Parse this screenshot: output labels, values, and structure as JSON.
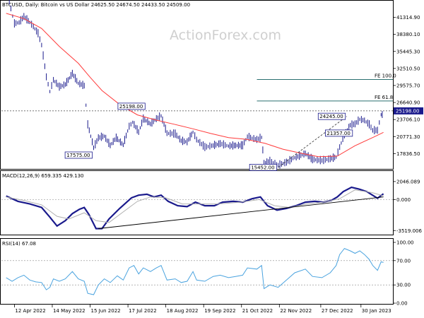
{
  "chart_data": [
    {
      "type": "candlestick",
      "panel": "price",
      "symbol_line": "BTCUSD, Daily:  Bitcoin vs US Dollar  24625.50  24674.50  24433.50  24509.00",
      "watermark": "ActionForex.com",
      "ylim": [
        15200,
        42600
      ],
      "y_ticks": [
        "41314.90",
        "38380.10",
        "35445.30",
        "32510.50",
        "29575.70",
        "26640.90",
        "23706.10",
        "20771.30",
        "17836.50"
      ],
      "x_dates": [
        "12 Apr 2022",
        "14 May 2022",
        "15 Jun 2022",
        "17 Jul 2022",
        "18 Aug 2022",
        "19 Sep 2022",
        "21 Oct 2022",
        "22 Nov 2022",
        "27 Dec 2022",
        "30 Jan 2023"
      ],
      "current_price": "25198.00",
      "current_price_value": 25198,
      "levels": [
        {
          "label": "FE 100.0",
          "value": 30600
        },
        {
          "label": "FE 61.8",
          "value": 26900
        },
        {
          "label": "",
          "value": 25198
        }
      ],
      "annotations": [
        {
          "label": "25198.00",
          "date": "2022-07-20",
          "value": 25198,
          "side": "above"
        },
        {
          "label": "17575.00",
          "date": "2022-06-18",
          "value": 17575,
          "side": "left"
        },
        {
          "label": "15452.00",
          "date": "2022-11-21",
          "value": 15452,
          "side": "left"
        },
        {
          "label": "24245.00",
          "date": "2023-01-18",
          "value": 24245,
          "side": "left"
        },
        {
          "label": "21357.00",
          "date": "2023-01-24",
          "value": 21357,
          "side": "left"
        }
      ],
      "close_path": [
        [
          "2022-04-05",
          46000
        ],
        [
          "2022-04-09",
          42800
        ],
        [
          "2022-04-12",
          40200
        ],
        [
          "2022-04-16",
          40400
        ],
        [
          "2022-04-20",
          41400
        ],
        [
          "2022-04-25",
          40400
        ],
        [
          "2022-04-28",
          39700
        ],
        [
          "2022-05-02",
          38500
        ],
        [
          "2022-05-05",
          36500
        ],
        [
          "2022-05-09",
          31000
        ],
        [
          "2022-05-12",
          28500
        ],
        [
          "2022-05-15",
          30500
        ],
        [
          "2022-05-20",
          29300
        ],
        [
          "2022-05-25",
          29700
        ],
        [
          "2022-05-31",
          31600
        ],
        [
          "2022-06-05",
          29900
        ],
        [
          "2022-06-10",
          29500
        ],
        [
          "2022-06-13",
          22800
        ],
        [
          "2022-06-18",
          18800
        ],
        [
          "2022-06-22",
          20500
        ],
        [
          "2022-06-27",
          20800
        ],
        [
          "2022-07-02",
          19200
        ],
        [
          "2022-07-07",
          20500
        ],
        [
          "2022-07-13",
          19300
        ],
        [
          "2022-07-18",
          22500
        ],
        [
          "2022-07-21",
          23200
        ],
        [
          "2022-07-26",
          21500
        ],
        [
          "2022-07-30",
          23800
        ],
        [
          "2022-08-05",
          22900
        ],
        [
          "2022-08-10",
          23800
        ],
        [
          "2022-08-14",
          24300
        ],
        [
          "2022-08-19",
          21300
        ],
        [
          "2022-08-26",
          21200
        ],
        [
          "2022-08-31",
          20000
        ],
        [
          "2022-09-05",
          19800
        ],
        [
          "2022-09-10",
          21500
        ],
        [
          "2022-09-13",
          20200
        ],
        [
          "2022-09-20",
          18900
        ],
        [
          "2022-09-27",
          19200
        ],
        [
          "2022-10-03",
          19500
        ],
        [
          "2022-10-10",
          19100
        ],
        [
          "2022-10-16",
          19200
        ],
        [
          "2022-10-22",
          19200
        ],
        [
          "2022-10-26",
          20700
        ],
        [
          "2022-11-03",
          20200
        ],
        [
          "2022-11-07",
          20600
        ],
        [
          "2022-11-09",
          16200
        ],
        [
          "2022-11-14",
          16500
        ],
        [
          "2022-11-21",
          15800
        ],
        [
          "2022-11-28",
          16300
        ],
        [
          "2022-12-05",
          17100
        ],
        [
          "2022-12-14",
          17800
        ],
        [
          "2022-12-20",
          16800
        ],
        [
          "2022-12-28",
          16600
        ],
        [
          "2023-01-04",
          16900
        ],
        [
          "2023-01-09",
          17200
        ],
        [
          "2023-01-12",
          18900
        ],
        [
          "2023-01-16",
          21100
        ],
        [
          "2023-01-21",
          22700
        ],
        [
          "2023-01-25",
          22900
        ],
        [
          "2023-01-29",
          23700
        ],
        [
          "2023-02-02",
          23500
        ],
        [
          "2023-02-06",
          22800
        ],
        [
          "2023-02-09",
          21800
        ],
        [
          "2023-02-13",
          21800
        ],
        [
          "2023-02-16",
          24500
        ],
        [
          "2023-02-18",
          24509
        ]
      ],
      "ma_path": [
        [
          "2022-04-05",
          42000
        ],
        [
          "2022-04-20",
          41100
        ],
        [
          "2022-05-05",
          39400
        ],
        [
          "2022-05-20",
          36300
        ],
        [
          "2022-06-05",
          33400
        ],
        [
          "2022-06-15",
          31000
        ],
        [
          "2022-06-25",
          28700
        ],
        [
          "2022-07-10",
          26300
        ],
        [
          "2022-07-25",
          24500
        ],
        [
          "2022-08-10",
          23600
        ],
        [
          "2022-08-25",
          22900
        ],
        [
          "2022-09-10",
          22100
        ],
        [
          "2022-09-25",
          21300
        ],
        [
          "2022-10-10",
          20600
        ],
        [
          "2022-10-25",
          20300
        ],
        [
          "2022-11-10",
          19600
        ],
        [
          "2022-11-25",
          18600
        ],
        [
          "2022-12-10",
          17900
        ],
        [
          "2022-12-25",
          17300
        ],
        [
          "2023-01-10",
          17400
        ],
        [
          "2023-01-25",
          19200
        ],
        [
          "2023-02-10",
          20700
        ],
        [
          "2023-02-18",
          21500
        ]
      ],
      "trend_path": [
        [
          "2022-11-21",
          15452
        ],
        [
          "2023-01-18",
          24245
        ]
      ]
    },
    {
      "type": "line",
      "panel": "macd",
      "label": "MACD(12,26,9) 659.335 429.130",
      "ylim": [
        -3900,
        2600
      ],
      "y_ticks": [
        "2046.089",
        "0.000",
        "-3519.006"
      ],
      "series": [
        {
          "name": "MACD",
          "color": "#1a1a8c",
          "points": [
            [
              "2022-04-05",
              400
            ],
            [
              "2022-04-15",
              -200
            ],
            [
              "2022-04-25",
              -500
            ],
            [
              "2022-05-05",
              -900
            ],
            [
              "2022-05-12",
              -2000
            ],
            [
              "2022-05-18",
              -3000
            ],
            [
              "2022-05-25",
              -2400
            ],
            [
              "2022-05-31",
              -1600
            ],
            [
              "2022-06-06",
              -1100
            ],
            [
              "2022-06-10",
              -900
            ],
            [
              "2022-06-14",
              -1700
            ],
            [
              "2022-06-20",
              -3300
            ],
            [
              "2022-06-25",
              -3300
            ],
            [
              "2022-07-01",
              -2200
            ],
            [
              "2022-07-10",
              -1000
            ],
            [
              "2022-07-20",
              200
            ],
            [
              "2022-07-26",
              500
            ],
            [
              "2022-08-02",
              600
            ],
            [
              "2022-08-08",
              300
            ],
            [
              "2022-08-14",
              500
            ],
            [
              "2022-08-20",
              -200
            ],
            [
              "2022-08-28",
              -700
            ],
            [
              "2022-09-05",
              -800
            ],
            [
              "2022-09-12",
              -300
            ],
            [
              "2022-09-20",
              -700
            ],
            [
              "2022-09-28",
              -700
            ],
            [
              "2022-10-05",
              -300
            ],
            [
              "2022-10-14",
              -200
            ],
            [
              "2022-10-22",
              -300
            ],
            [
              "2022-10-30",
              100
            ],
            [
              "2022-11-06",
              300
            ],
            [
              "2022-11-12",
              -700
            ],
            [
              "2022-11-20",
              -1200
            ],
            [
              "2022-11-28",
              -1000
            ],
            [
              "2022-12-06",
              -700
            ],
            [
              "2022-12-14",
              -300
            ],
            [
              "2022-12-22",
              -200
            ],
            [
              "2022-12-29",
              -300
            ],
            [
              "2023-01-05",
              -100
            ],
            [
              "2023-01-10",
              300
            ],
            [
              "2023-01-15",
              900
            ],
            [
              "2023-01-22",
              1400
            ],
            [
              "2023-01-28",
              1200
            ],
            [
              "2023-02-04",
              900
            ],
            [
              "2023-02-10",
              400
            ],
            [
              "2023-02-13",
              150
            ],
            [
              "2023-02-18",
              659
            ]
          ]
        },
        {
          "name": "Signal",
          "color": "#b0b0b0",
          "points": [
            [
              "2022-04-05",
              300
            ],
            [
              "2022-04-20",
              -100
            ],
            [
              "2022-05-05",
              -600
            ],
            [
              "2022-05-18",
              -1900
            ],
            [
              "2022-05-28",
              -2200
            ],
            [
              "2022-06-10",
              -1500
            ],
            [
              "2022-06-20",
              -2400
            ],
            [
              "2022-07-01",
              -2600
            ],
            [
              "2022-07-12",
              -1500
            ],
            [
              "2022-07-25",
              -200
            ],
            [
              "2022-08-05",
              300
            ],
            [
              "2022-08-18",
              200
            ],
            [
              "2022-09-01",
              -500
            ],
            [
              "2022-09-15",
              -500
            ],
            [
              "2022-10-01",
              -500
            ],
            [
              "2022-10-20",
              -300
            ],
            [
              "2022-11-05",
              0
            ],
            [
              "2022-11-18",
              -700
            ],
            [
              "2022-12-01",
              -900
            ],
            [
              "2022-12-15",
              -500
            ],
            [
              "2022-12-29",
              -300
            ],
            [
              "2023-01-12",
              100
            ],
            [
              "2023-01-25",
              1100
            ],
            [
              "2023-02-08",
              800
            ],
            [
              "2023-02-18",
              429
            ]
          ]
        }
      ],
      "trend_path": [
        [
          "2022-06-22",
          -3300
        ],
        [
          "2023-02-18",
          300
        ]
      ]
    },
    {
      "type": "line",
      "panel": "rsi",
      "label": "RSI(14) 67.08",
      "ylim": [
        0,
        100
      ],
      "y_ticks": [
        "100.00",
        "70.00",
        "30.00",
        "0.00"
      ],
      "series": [
        {
          "name": "RSI",
          "color": "#4aa3df",
          "points": [
            [
              "2022-04-05",
              42
            ],
            [
              "2022-04-10",
              36
            ],
            [
              "2022-04-15",
              42
            ],
            [
              "2022-04-20",
              46
            ],
            [
              "2022-04-25",
              38
            ],
            [
              "2022-04-30",
              35
            ],
            [
              "2022-05-05",
              34
            ],
            [
              "2022-05-09",
              22
            ],
            [
              "2022-05-12",
              26
            ],
            [
              "2022-05-15",
              40
            ],
            [
              "2022-05-20",
              36
            ],
            [
              "2022-05-25",
              40
            ],
            [
              "2022-05-31",
              52
            ],
            [
              "2022-06-05",
              40
            ],
            [
              "2022-06-10",
              36
            ],
            [
              "2022-06-13",
              16
            ],
            [
              "2022-06-18",
              14
            ],
            [
              "2022-06-22",
              30
            ],
            [
              "2022-06-27",
              40
            ],
            [
              "2022-07-02",
              34
            ],
            [
              "2022-07-08",
              45
            ],
            [
              "2022-07-13",
              38
            ],
            [
              "2022-07-18",
              58
            ],
            [
              "2022-07-22",
              62
            ],
            [
              "2022-07-26",
              48
            ],
            [
              "2022-07-30",
              58
            ],
            [
              "2022-08-05",
              52
            ],
            [
              "2022-08-10",
              58
            ],
            [
              "2022-08-14",
              62
            ],
            [
              "2022-08-19",
              38
            ],
            [
              "2022-08-26",
              40
            ],
            [
              "2022-08-31",
              34
            ],
            [
              "2022-09-05",
              36
            ],
            [
              "2022-09-10",
              52
            ],
            [
              "2022-09-13",
              38
            ],
            [
              "2022-09-20",
              36
            ],
            [
              "2022-09-27",
              44
            ],
            [
              "2022-10-03",
              46
            ],
            [
              "2022-10-10",
              42
            ],
            [
              "2022-10-16",
              44
            ],
            [
              "2022-10-22",
              46
            ],
            [
              "2022-10-26",
              58
            ],
            [
              "2022-11-03",
              56
            ],
            [
              "2022-11-07",
              62
            ],
            [
              "2022-11-09",
              24
            ],
            [
              "2022-11-14",
              30
            ],
            [
              "2022-11-21",
              26
            ],
            [
              "2022-11-28",
              38
            ],
            [
              "2022-12-05",
              50
            ],
            [
              "2022-12-14",
              56
            ],
            [
              "2022-12-20",
              44
            ],
            [
              "2022-12-28",
              42
            ],
            [
              "2023-01-04",
              50
            ],
            [
              "2023-01-09",
              62
            ],
            [
              "2023-01-12",
              80
            ],
            [
              "2023-01-16",
              90
            ],
            [
              "2023-01-21",
              86
            ],
            [
              "2023-01-25",
              82
            ],
            [
              "2023-01-29",
              86
            ],
            [
              "2023-02-02",
              80
            ],
            [
              "2023-02-06",
              72
            ],
            [
              "2023-02-09",
              62
            ],
            [
              "2023-02-13",
              54
            ],
            [
              "2023-02-16",
              68
            ],
            [
              "2023-02-18",
              67
            ]
          ]
        }
      ]
    }
  ],
  "colors": {
    "candle_up": "#1a1a8c",
    "candle_down": "#1a1a8c",
    "ma": "#ff3b3b",
    "fe_line": "#2a6f6f",
    "current_price_line": "#444444",
    "pricetag_bg": "#1a1a8c"
  }
}
